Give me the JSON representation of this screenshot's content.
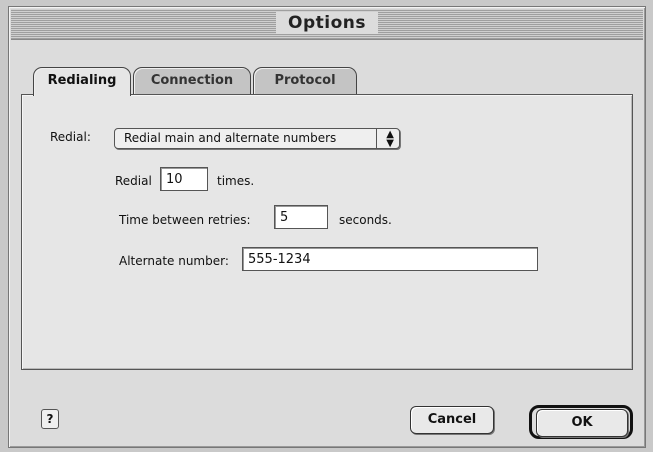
{
  "window": {
    "title": "Options"
  },
  "tabs": [
    {
      "label": "Redialing",
      "active": true
    },
    {
      "label": "Connection",
      "active": false
    },
    {
      "label": "Protocol",
      "active": false
    }
  ],
  "redial": {
    "label": "Redial:",
    "selected": "Redial main and alternate numbers",
    "count_prefix": "Redial",
    "count_value": "10",
    "count_suffix": "times.",
    "interval_label": "Time between retries:",
    "interval_value": "5",
    "interval_suffix": "seconds.",
    "alternate_label": "Alternate number:",
    "alternate_value": "555-1234"
  },
  "buttons": {
    "help": "?",
    "cancel": "Cancel",
    "ok": "OK"
  },
  "colors": {
    "window_bg": "#dcdcdc",
    "panel_bg": "#e6e6e6"
  }
}
